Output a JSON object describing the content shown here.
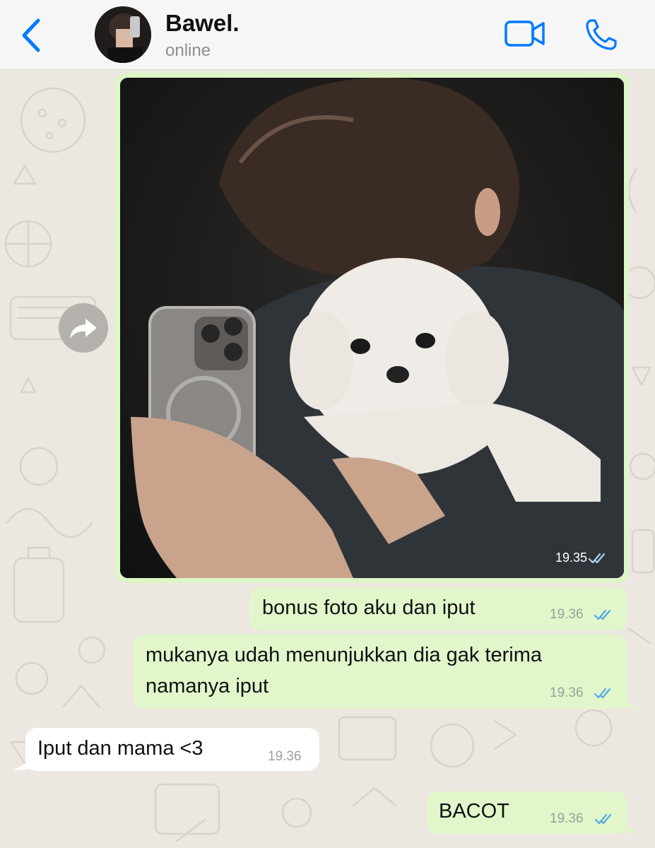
{
  "header": {
    "contact_name": "Bawel.",
    "status": "online"
  },
  "colors": {
    "accent": "#007aff",
    "outgoing_bubble": "#e1f7cb",
    "incoming_bubble": "#ffffff",
    "chat_background": "#ece8e1",
    "read_tick": "#53a9e0"
  },
  "icons": {
    "back": "chevron-left-icon",
    "video": "video-camera-icon",
    "call": "phone-icon",
    "forward": "forward-arrow-icon",
    "read": "double-check-icon"
  },
  "messages": [
    {
      "type": "image",
      "direction": "out",
      "time": "19.35",
      "read": true
    },
    {
      "type": "text",
      "direction": "out",
      "text": "bonus foto aku dan iput",
      "time": "19.36",
      "read": true
    },
    {
      "type": "text",
      "direction": "out",
      "lines": [
        "mukanya udah menunjukkan dia gak terima",
        "namanya iput"
      ],
      "time": "19.36",
      "read": true
    },
    {
      "type": "text",
      "direction": "in",
      "text": "Iput dan mama <3",
      "time": "19.36"
    },
    {
      "type": "text",
      "direction": "out",
      "text": "BACOT",
      "time": "19.36",
      "read": true
    }
  ]
}
